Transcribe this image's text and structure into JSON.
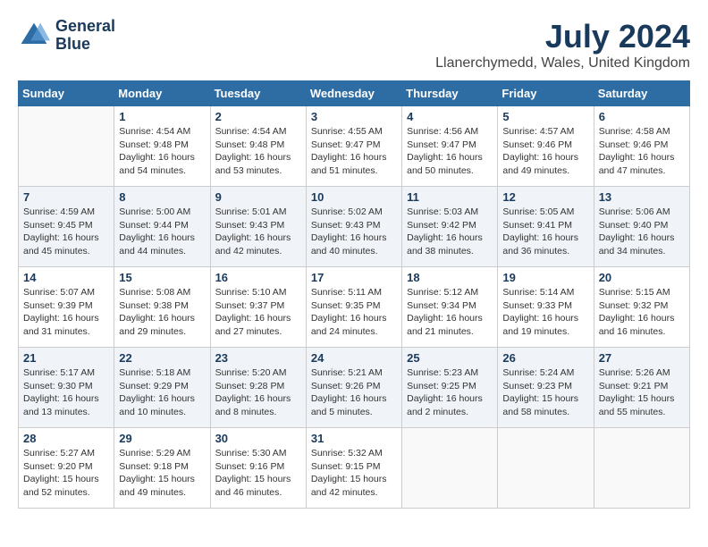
{
  "logo": {
    "line1": "General",
    "line2": "Blue"
  },
  "title": "July 2024",
  "location": "Llanerchymedd, Wales, United Kingdom",
  "weekdays": [
    "Sunday",
    "Monday",
    "Tuesday",
    "Wednesday",
    "Thursday",
    "Friday",
    "Saturday"
  ],
  "weeks": [
    [
      {
        "day": "",
        "sunrise": "",
        "sunset": "",
        "daylight": ""
      },
      {
        "day": "1",
        "sunrise": "Sunrise: 4:54 AM",
        "sunset": "Sunset: 9:48 PM",
        "daylight": "Daylight: 16 hours and 54 minutes."
      },
      {
        "day": "2",
        "sunrise": "Sunrise: 4:54 AM",
        "sunset": "Sunset: 9:48 PM",
        "daylight": "Daylight: 16 hours and 53 minutes."
      },
      {
        "day": "3",
        "sunrise": "Sunrise: 4:55 AM",
        "sunset": "Sunset: 9:47 PM",
        "daylight": "Daylight: 16 hours and 51 minutes."
      },
      {
        "day": "4",
        "sunrise": "Sunrise: 4:56 AM",
        "sunset": "Sunset: 9:47 PM",
        "daylight": "Daylight: 16 hours and 50 minutes."
      },
      {
        "day": "5",
        "sunrise": "Sunrise: 4:57 AM",
        "sunset": "Sunset: 9:46 PM",
        "daylight": "Daylight: 16 hours and 49 minutes."
      },
      {
        "day": "6",
        "sunrise": "Sunrise: 4:58 AM",
        "sunset": "Sunset: 9:46 PM",
        "daylight": "Daylight: 16 hours and 47 minutes."
      }
    ],
    [
      {
        "day": "7",
        "sunrise": "Sunrise: 4:59 AM",
        "sunset": "Sunset: 9:45 PM",
        "daylight": "Daylight: 16 hours and 45 minutes."
      },
      {
        "day": "8",
        "sunrise": "Sunrise: 5:00 AM",
        "sunset": "Sunset: 9:44 PM",
        "daylight": "Daylight: 16 hours and 44 minutes."
      },
      {
        "day": "9",
        "sunrise": "Sunrise: 5:01 AM",
        "sunset": "Sunset: 9:43 PM",
        "daylight": "Daylight: 16 hours and 42 minutes."
      },
      {
        "day": "10",
        "sunrise": "Sunrise: 5:02 AM",
        "sunset": "Sunset: 9:43 PM",
        "daylight": "Daylight: 16 hours and 40 minutes."
      },
      {
        "day": "11",
        "sunrise": "Sunrise: 5:03 AM",
        "sunset": "Sunset: 9:42 PM",
        "daylight": "Daylight: 16 hours and 38 minutes."
      },
      {
        "day": "12",
        "sunrise": "Sunrise: 5:05 AM",
        "sunset": "Sunset: 9:41 PM",
        "daylight": "Daylight: 16 hours and 36 minutes."
      },
      {
        "day": "13",
        "sunrise": "Sunrise: 5:06 AM",
        "sunset": "Sunset: 9:40 PM",
        "daylight": "Daylight: 16 hours and 34 minutes."
      }
    ],
    [
      {
        "day": "14",
        "sunrise": "Sunrise: 5:07 AM",
        "sunset": "Sunset: 9:39 PM",
        "daylight": "Daylight: 16 hours and 31 minutes."
      },
      {
        "day": "15",
        "sunrise": "Sunrise: 5:08 AM",
        "sunset": "Sunset: 9:38 PM",
        "daylight": "Daylight: 16 hours and 29 minutes."
      },
      {
        "day": "16",
        "sunrise": "Sunrise: 5:10 AM",
        "sunset": "Sunset: 9:37 PM",
        "daylight": "Daylight: 16 hours and 27 minutes."
      },
      {
        "day": "17",
        "sunrise": "Sunrise: 5:11 AM",
        "sunset": "Sunset: 9:35 PM",
        "daylight": "Daylight: 16 hours and 24 minutes."
      },
      {
        "day": "18",
        "sunrise": "Sunrise: 5:12 AM",
        "sunset": "Sunset: 9:34 PM",
        "daylight": "Daylight: 16 hours and 21 minutes."
      },
      {
        "day": "19",
        "sunrise": "Sunrise: 5:14 AM",
        "sunset": "Sunset: 9:33 PM",
        "daylight": "Daylight: 16 hours and 19 minutes."
      },
      {
        "day": "20",
        "sunrise": "Sunrise: 5:15 AM",
        "sunset": "Sunset: 9:32 PM",
        "daylight": "Daylight: 16 hours and 16 minutes."
      }
    ],
    [
      {
        "day": "21",
        "sunrise": "Sunrise: 5:17 AM",
        "sunset": "Sunset: 9:30 PM",
        "daylight": "Daylight: 16 hours and 13 minutes."
      },
      {
        "day": "22",
        "sunrise": "Sunrise: 5:18 AM",
        "sunset": "Sunset: 9:29 PM",
        "daylight": "Daylight: 16 hours and 10 minutes."
      },
      {
        "day": "23",
        "sunrise": "Sunrise: 5:20 AM",
        "sunset": "Sunset: 9:28 PM",
        "daylight": "Daylight: 16 hours and 8 minutes."
      },
      {
        "day": "24",
        "sunrise": "Sunrise: 5:21 AM",
        "sunset": "Sunset: 9:26 PM",
        "daylight": "Daylight: 16 hours and 5 minutes."
      },
      {
        "day": "25",
        "sunrise": "Sunrise: 5:23 AM",
        "sunset": "Sunset: 9:25 PM",
        "daylight": "Daylight: 16 hours and 2 minutes."
      },
      {
        "day": "26",
        "sunrise": "Sunrise: 5:24 AM",
        "sunset": "Sunset: 9:23 PM",
        "daylight": "Daylight: 15 hours and 58 minutes."
      },
      {
        "day": "27",
        "sunrise": "Sunrise: 5:26 AM",
        "sunset": "Sunset: 9:21 PM",
        "daylight": "Daylight: 15 hours and 55 minutes."
      }
    ],
    [
      {
        "day": "28",
        "sunrise": "Sunrise: 5:27 AM",
        "sunset": "Sunset: 9:20 PM",
        "daylight": "Daylight: 15 hours and 52 minutes."
      },
      {
        "day": "29",
        "sunrise": "Sunrise: 5:29 AM",
        "sunset": "Sunset: 9:18 PM",
        "daylight": "Daylight: 15 hours and 49 minutes."
      },
      {
        "day": "30",
        "sunrise": "Sunrise: 5:30 AM",
        "sunset": "Sunset: 9:16 PM",
        "daylight": "Daylight: 15 hours and 46 minutes."
      },
      {
        "day": "31",
        "sunrise": "Sunrise: 5:32 AM",
        "sunset": "Sunset: 9:15 PM",
        "daylight": "Daylight: 15 hours and 42 minutes."
      },
      {
        "day": "",
        "sunrise": "",
        "sunset": "",
        "daylight": ""
      },
      {
        "day": "",
        "sunrise": "",
        "sunset": "",
        "daylight": ""
      },
      {
        "day": "",
        "sunrise": "",
        "sunset": "",
        "daylight": ""
      }
    ]
  ]
}
